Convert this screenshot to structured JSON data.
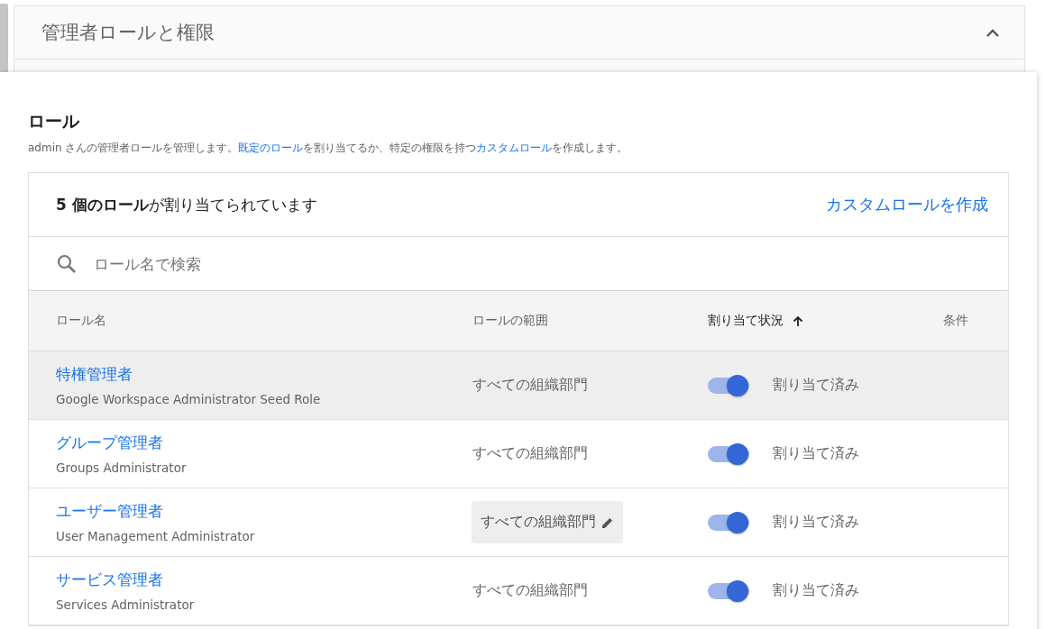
{
  "section": {
    "title": "管理者ロールと権限",
    "expanded": true
  },
  "roles_card": {
    "title": "ロール",
    "description": [
      {
        "text": "admin さんの管理者ロールを管理します。",
        "kind": "text"
      },
      {
        "text": "既定のロール",
        "kind": "link"
      },
      {
        "text": "を割り当てるか、特定の権限を持つ",
        "kind": "text"
      },
      {
        "text": "カスタムロール",
        "kind": "link"
      },
      {
        "text": "を作成します。",
        "kind": "text"
      }
    ],
    "count": "**5 個のロール**が割り当てられています",
    "create_link": "カスタムロールを作成",
    "search": {
      "placeholder": "ロール名で検索"
    },
    "columns": [
      {
        "label": "ロール名",
        "sorted": false
      },
      {
        "label": "ロールの範囲",
        "sorted": false
      },
      {
        "label": "割り当て状況",
        "sorted": true
      },
      {
        "label": "条件",
        "sorted": false
      }
    ],
    "rows": [
      {
        "name": "特権管理者",
        "subtitle": "Google Workspace Administrator Seed Role",
        "scope": "すべての組織部門",
        "editable": false,
        "on": true,
        "status": "割り当て済み",
        "highlighted": true
      },
      {
        "name": "グループ管理者",
        "subtitle": "Groups Administrator",
        "scope": "すべての組織部門",
        "editable": false,
        "on": true,
        "status": "割り当て済み",
        "highlighted": false
      },
      {
        "name": "ユーザー管理者",
        "subtitle": "User Management Administrator",
        "scope": "すべての組織部門",
        "editable": true,
        "on": true,
        "status": "割り当て済み",
        "highlighted": false
      },
      {
        "name": "サービス管理者",
        "subtitle": "Services Administrator",
        "scope": "すべての組織部門",
        "editable": false,
        "on": true,
        "status": "割り当て済み",
        "highlighted": false
      }
    ]
  }
}
